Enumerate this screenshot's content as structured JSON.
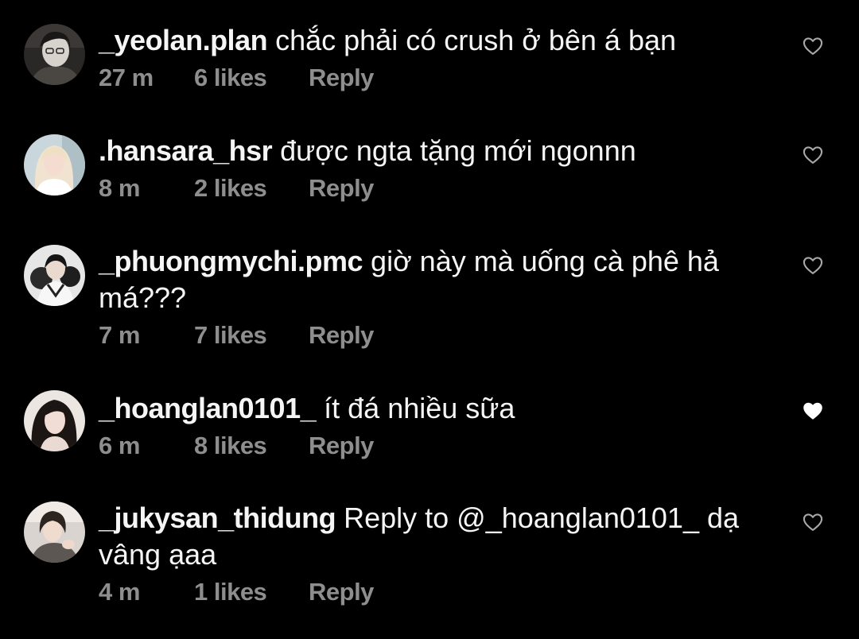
{
  "comments": [
    {
      "username": "_yeolan.plan",
      "text": "chắc phải có crush ở bên á bạn",
      "time": "27 m",
      "likes": "6 likes",
      "reply": "Reply",
      "liked": false,
      "avatar_icon": "user-avatar-photo"
    },
    {
      "username": ".hansara_hsr",
      "text": "được ngta tặng mới ngonnn",
      "time": "8 m",
      "likes": "2 likes",
      "reply": "Reply",
      "liked": false,
      "avatar_icon": "user-avatar-photo"
    },
    {
      "username": "_phuongmychi.pmc",
      "text": "giờ này mà uống cà phê hả má???",
      "time": "7 m",
      "likes": "7 likes",
      "reply": "Reply",
      "liked": false,
      "avatar_icon": "user-avatar-photo"
    },
    {
      "username": "_hoanglan0101_",
      "text": "ít đá nhiều sữa",
      "time": "6 m",
      "likes": "8 likes",
      "reply": "Reply",
      "liked": true,
      "avatar_icon": "user-avatar-photo"
    },
    {
      "username": "_jukysan_thidung",
      "text": "Reply to @_hoanglan0101_ dạ vâng ạaa",
      "time": "4 m",
      "likes": "1 likes",
      "reply": "Reply",
      "liked": false,
      "avatar_icon": "user-avatar-photo"
    }
  ],
  "colors": {
    "background": "#000000",
    "text": "#f5f5f5",
    "meta": "#8e8e8e",
    "heart_outline": "#a8a8a8",
    "heart_filled": "#ffffff"
  },
  "icons": {
    "like": "heart-icon",
    "liked": "heart-filled-icon"
  }
}
